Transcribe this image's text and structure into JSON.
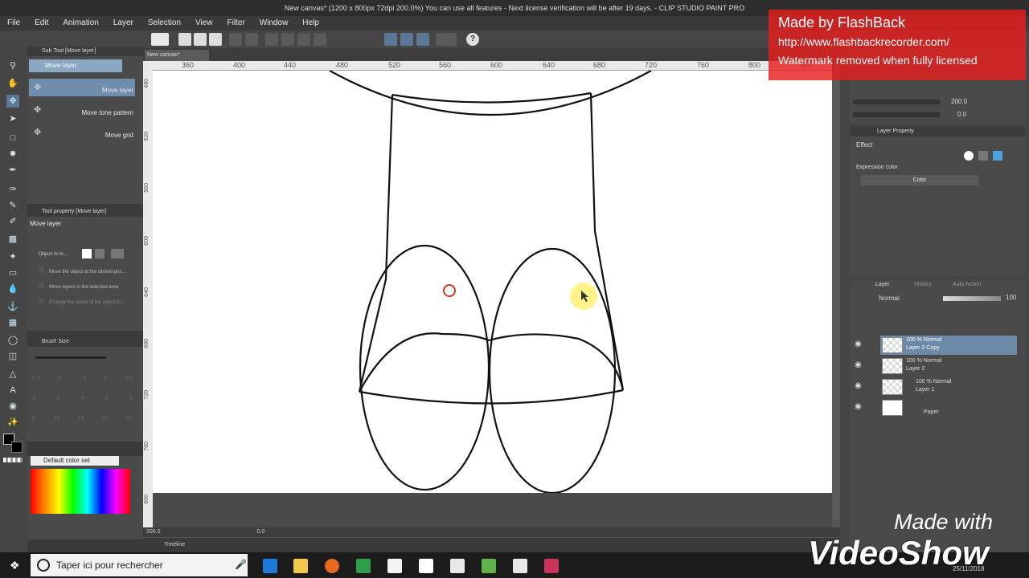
{
  "window": {
    "title": "New canvas* (1200 x 800px 72dpi 200.0%)  You can use all features - Next license verification will be after 19 days. - CLIP STUDIO PAINT PRO"
  },
  "menu": [
    "File",
    "Edit",
    "Animation",
    "Layer",
    "Selection",
    "View",
    "Filter",
    "Window",
    "Help"
  ],
  "subtool_panel": {
    "header": "Sub Tool [Move layer]",
    "tab": "Move layer",
    "items": [
      "Move layer",
      "Move tone pattern",
      "Move grid"
    ]
  },
  "tool_property": {
    "header": "Tool property [Move layer]",
    "title": "Move layer",
    "object_label": "Object to m...",
    "options": [
      "Move the object at the clicked pos...",
      "Move layers in the selected area",
      "Change the status of the object to..."
    ]
  },
  "brush_size": {
    "header": "Brush Size",
    "sizes": [
      "0.7",
      "1",
      "1.5",
      "2",
      "2.5",
      "3",
      "4",
      "5",
      "6",
      "7",
      "8",
      "10",
      "12",
      "15",
      "17"
    ]
  },
  "color_set": {
    "header": "Default color set"
  },
  "canvas": {
    "tab": "New canvas*",
    "ruler_h": [
      "360",
      "400",
      "440",
      "480",
      "520",
      "560",
      "600",
      "640",
      "680",
      "720",
      "760",
      "800",
      "840"
    ],
    "ruler_v": [
      "480",
      "520",
      "560",
      "600",
      "640",
      "680",
      "720",
      "760",
      "800"
    ],
    "zoom": "200.0",
    "rotation": "0.0"
  },
  "timeline_label": "Timeline",
  "navigator": {
    "zoom": "200.0",
    "rotate": "0.0"
  },
  "layer_property": {
    "header": "Layer Property",
    "effect_label": "Effect",
    "expression_label": "Expression color",
    "expression_value": "Color"
  },
  "layer_panel": {
    "tabs": [
      "Layer",
      "History",
      "Auto Action"
    ],
    "blend_mode": "Normal",
    "opacity": "100",
    "layers": [
      {
        "line1": "100 % Normal",
        "line2": "Layer 2 Copy",
        "selected": true
      },
      {
        "line1": "100 % Normal",
        "line2": "Layer 2",
        "selected": false
      },
      {
        "line1": "100 % Normal",
        "line2": "Layer 1",
        "selected": false
      },
      {
        "line1": "",
        "line2": "Paper",
        "selected": false
      }
    ]
  },
  "watermark": {
    "line1": "Made by FlashBack",
    "line2": "http://www.flashbackrecorder.com/",
    "line3": "Watermark removed when fully licensed"
  },
  "videoshow": {
    "line1": "Made with",
    "line2": "VideoShow"
  },
  "taskbar": {
    "search_placeholder": "Taper ici pour rechercher",
    "date": "25/11/2018"
  }
}
